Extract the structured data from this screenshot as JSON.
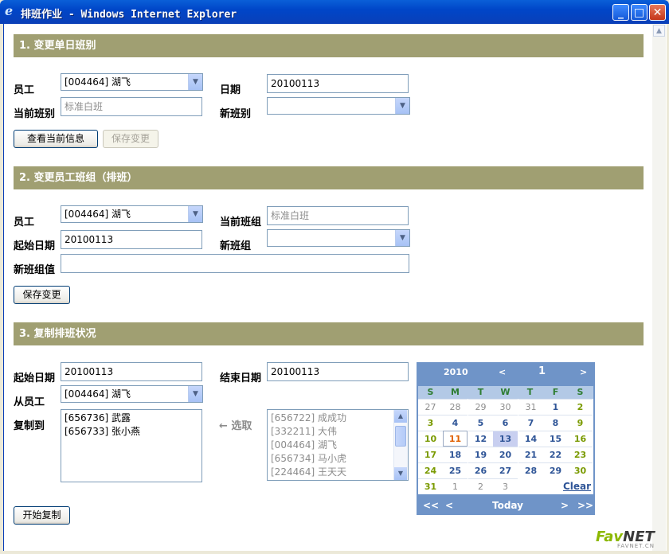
{
  "window": {
    "title": "排班作业 - Windows Internet Explorer",
    "icon": "ie-logo-icon"
  },
  "section1": {
    "title": "1. 变更单日班别",
    "employee_label": "员工",
    "employee_value": "[004464] 湖飞",
    "date_label": "日期",
    "date_value": "20100113",
    "current_shift_label": "当前班别",
    "current_shift_value": "标准白班",
    "new_shift_label": "新班别",
    "new_shift_value": "",
    "view_button": "查看当前信息",
    "save_button": "保存变更"
  },
  "section2": {
    "title": "2. 变更员工班组（排班）",
    "employee_label": "员工",
    "employee_value": "[004464] 湖飞",
    "current_group_label": "当前班组",
    "current_group_value": "标准白班",
    "start_date_label": "起始日期",
    "start_date_value": "20100113",
    "new_group_label": "新班组",
    "new_group_value": "",
    "group_value_label": "新班组值",
    "group_value_value": "",
    "save_button": "保存变更"
  },
  "section3": {
    "title": "3. 复制排班状况",
    "start_date_label": "起始日期",
    "start_date_value": "20100113",
    "end_date_label": "结束日期",
    "end_date_value": "20100113",
    "from_employee_label": "从员工",
    "from_employee_value": "[004464] 湖飞",
    "copy_to_label": "复制到",
    "copy_to_items": [
      "[656736] 武露",
      "[656733] 张小燕"
    ],
    "picker_label": "← 选取",
    "available_items": [
      "[656722] 成成功",
      "[332211] 大伟",
      "[004464] 湖飞",
      "[656734] 马小虎",
      "[224464] 王天天"
    ],
    "start_copy_button": "开始复制"
  },
  "calendar": {
    "year": "2010",
    "prev_month": "<",
    "month": "1",
    "next_month": ">",
    "weekdays": [
      "S",
      "M",
      "T",
      "W",
      "T",
      "F",
      "S"
    ],
    "weeks": [
      [
        "27",
        "28",
        "29",
        "30",
        "31",
        "1",
        "2"
      ],
      [
        "3",
        "4",
        "5",
        "6",
        "7",
        "8",
        "9"
      ],
      [
        "10",
        "11",
        "12",
        "13",
        "14",
        "15",
        "16"
      ],
      [
        "17",
        "18",
        "19",
        "20",
        "21",
        "22",
        "23"
      ],
      [
        "24",
        "25",
        "26",
        "27",
        "28",
        "29",
        "30"
      ],
      [
        "31",
        "1",
        "2",
        "3"
      ]
    ],
    "today": "11",
    "selected": "13",
    "clear_label": "Clear",
    "prev_year": "<<",
    "prev": "<",
    "today_label": "Today",
    "next": ">",
    "next_year": ">>"
  },
  "watermark": {
    "fav": "Fav",
    "net": "NET",
    "sub": "FAVNET.CN"
  }
}
